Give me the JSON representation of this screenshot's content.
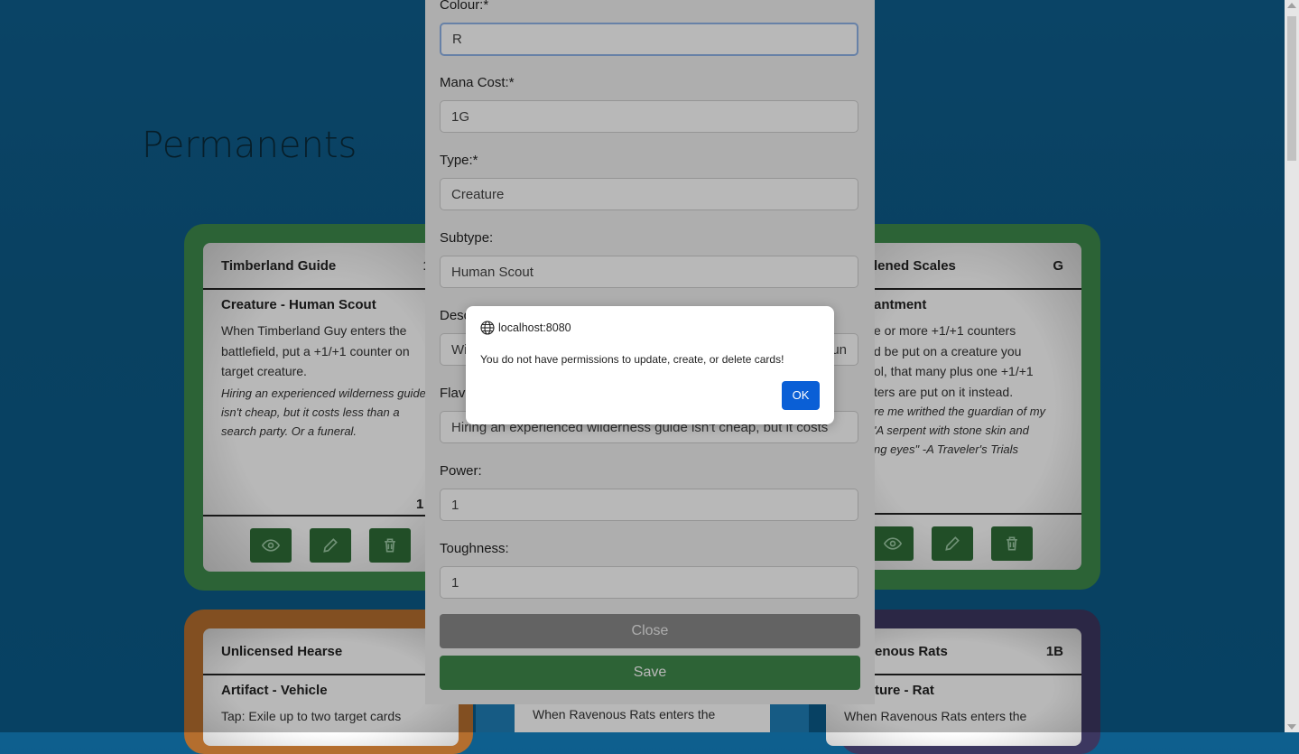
{
  "page": {
    "title": "Permanents"
  },
  "cards": [
    {
      "name": "Timberland Guide",
      "cost": "1",
      "type_line": "Creature - Human Scout",
      "description": "When Timberland Guy enters the battlefield, put a +1/+1 counter on target creature.",
      "flavor": "Hiring an experienced wilderness guide isn't cheap, but it costs less than a search party. Or a funeral.",
      "pt": "1",
      "frame_color": "#3e8a4b"
    },
    {
      "name": "Hardened Scales",
      "name_visible": "lened Scales",
      "cost": "G",
      "type_line": "antment",
      "description": "e or more +1/+1 counters\nd be put on a creature you\nol, that many plus one +1/+1\nters are put on it instead.",
      "flavor": "re me writhed the guardian of my\n'A serpent with stone skin and\nng eyes\" -A Traveler's Trials",
      "frame_color": "#3e8a4b"
    },
    {
      "name": "Unlicensed Hearse",
      "type_line": "Artifact - Vehicle",
      "description": "Tap: Exile up to two target cards",
      "frame_color": "#b46e2e"
    },
    {
      "name_visible": "enous Rats",
      "cost": "1B",
      "type_line": "ture - Rat",
      "description": "When Ravenous Rats enters the",
      "frame_color": "#3c3760"
    },
    {
      "description": "When Ravenous Rats enters the"
    }
  ],
  "form": {
    "colour": {
      "label": "Colour:*",
      "value": "R"
    },
    "mana_cost": {
      "label": "Mana Cost:*",
      "value": "1G"
    },
    "type": {
      "label": "Type:*",
      "value": "Creature"
    },
    "subtype": {
      "label": "Subtype:",
      "value": "Human Scout"
    },
    "description": {
      "label_visible": "Desc",
      "value_visible_left": "Wi",
      "value_visible_right": "un"
    },
    "flavor": {
      "label_visible": "Flavo",
      "value": "Hiring an experienced wilderness guide isn't cheap, but it costs"
    },
    "power": {
      "label": "Power:",
      "value": "1"
    },
    "toughness": {
      "label": "Toughness:",
      "value": "1"
    },
    "close_label": "Close",
    "save_label": "Save"
  },
  "alert": {
    "origin": "localhost:8080",
    "message": "You do not have permissions to update, create, or delete cards!",
    "ok_label": "OK"
  },
  "colors": {
    "green_button": "#2e6d37",
    "save_button": "#3f8a4c",
    "ok_button": "#0a5fd6"
  },
  "icons": [
    "eye-icon",
    "pencil-icon",
    "trash-icon",
    "globe-icon"
  ]
}
